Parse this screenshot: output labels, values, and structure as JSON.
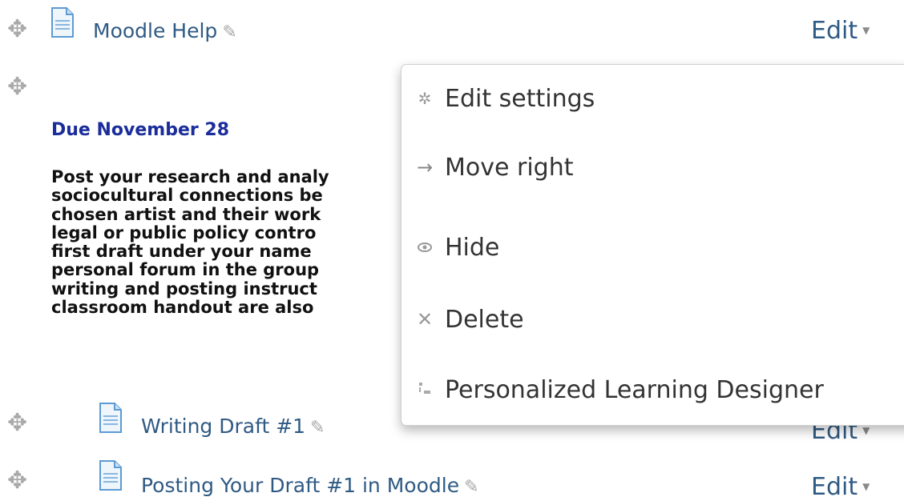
{
  "rows": [
    {
      "link": "Moodle Help",
      "edit": "Edit"
    },
    {
      "link": "Writing Draft #1",
      "edit": "Edit"
    },
    {
      "link": "Posting Your Draft #1 in Moodle",
      "edit": "Edit"
    }
  ],
  "label": {
    "due": "Due November 28",
    "description": "Post your research and analy\nsociocultural connections be\nchosen artist and their work\nlegal or public policy contro\nfirst draft under your name\npersonal forum in the group\nwriting and posting instruct\nclassroom handout are also"
  },
  "menu": {
    "items": [
      {
        "label": "Edit settings",
        "icon": "gear-icon"
      },
      {
        "label": "Move right",
        "icon": "arrow-right-icon"
      },
      {
        "label": "Hide",
        "icon": "eye-icon"
      },
      {
        "label": "Delete",
        "icon": "close-icon"
      },
      {
        "label": "Personalized Learning Designer",
        "icon": "pld-icon"
      }
    ]
  },
  "colors": {
    "link": "#2f5a84",
    "due": "#1b2d9b",
    "icon_gray": "#a9a9a9"
  }
}
